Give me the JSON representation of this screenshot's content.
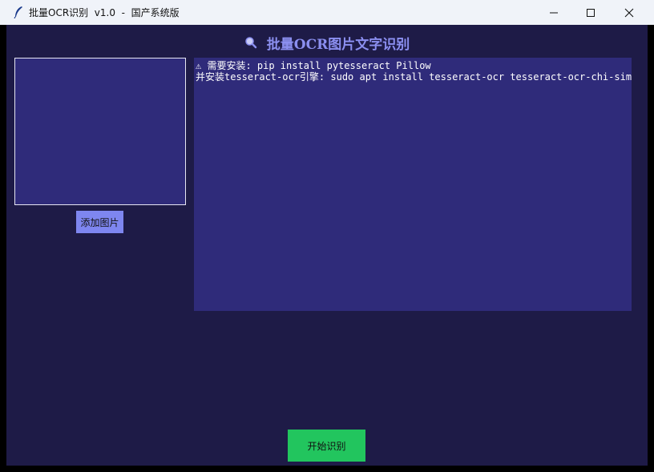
{
  "window": {
    "title": "批量OCR识别  v1.0  -  国产系统版",
    "icon": "feather-icon"
  },
  "titlebar_controls": {
    "minimize": "minimize-icon",
    "maximize": "maximize-icon",
    "close": "close-icon"
  },
  "main": {
    "heading": "批量OCR图片文字识别",
    "heading_icon": "magnifier-icon",
    "add_image_button": "添加图片",
    "output_lines": [
      "⚠ 需要安装: pip install pytesseract Pillow",
      "并安装tesseract-ocr引擎: sudo apt install tesseract-ocr tesseract-ocr-chi-sim"
    ],
    "start_button": "开始识别"
  },
  "colors": {
    "background": "#1e1b47",
    "panel": "#2f2b7a",
    "accent": "#7e86f0",
    "heading": "#8b8ff0",
    "start": "#22c55e"
  }
}
